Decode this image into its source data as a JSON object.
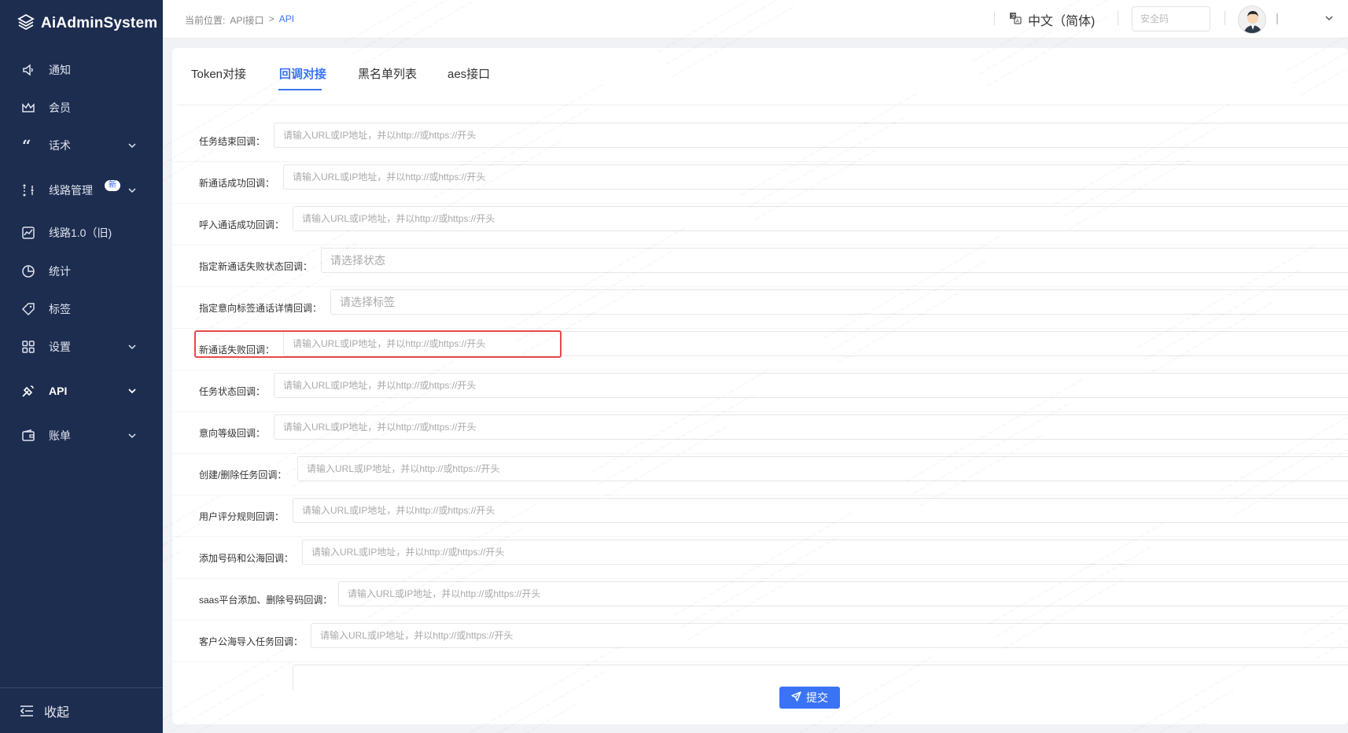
{
  "app": {
    "title": "AiAdminSystem"
  },
  "sidebar": {
    "items": [
      {
        "label": "通知",
        "icon": "speaker-icon",
        "has_chevron": false
      },
      {
        "label": "会员",
        "icon": "crown-icon",
        "has_chevron": false
      },
      {
        "label": "话术",
        "icon": "quote-icon",
        "has_chevron": true
      },
      {
        "label": "线路管理",
        "icon": "route-icon",
        "has_chevron": true,
        "badge": "新"
      },
      {
        "label": "线路1.0（旧)",
        "icon": "chart-box-icon",
        "has_chevron": false
      },
      {
        "label": "统计",
        "icon": "pie-icon",
        "has_chevron": false
      },
      {
        "label": "标签",
        "icon": "tag-icon",
        "has_chevron": false
      },
      {
        "label": "设置",
        "icon": "grid-icon",
        "has_chevron": true
      },
      {
        "label": "API",
        "icon": "satellite-icon",
        "has_chevron": true,
        "active": true
      },
      {
        "label": "账单",
        "icon": "wallet-icon",
        "has_chevron": true
      }
    ],
    "collapse_label": "收起"
  },
  "header": {
    "breadcrumb_prefix": "当前位置:",
    "breadcrumb_parent": "API接口",
    "breadcrumb_sep": ">",
    "breadcrumb_current": "API",
    "language": "中文（简体)",
    "safe_code_placeholder": "安全码"
  },
  "tabs": [
    {
      "label": "Token对接"
    },
    {
      "label": "回调对接",
      "active": true
    },
    {
      "label": "黑名单列表"
    },
    {
      "label": "aes接口"
    }
  ],
  "form": {
    "rows": [
      {
        "label": "任务结束回调：",
        "placeholder": "请输入URL或IP地址，并以http://或https://开头"
      },
      {
        "label": "新通话成功回调：",
        "placeholder": "请输入URL或IP地址，并以http://或https://开头"
      },
      {
        "label": "呼入通话成功回调：",
        "placeholder": "请输入URL或IP地址，并以http://或https://开头"
      },
      {
        "label": "指定新通话失败状态回调：",
        "placeholder": "请选择状态"
      },
      {
        "label": "指定意向标签通话详情回调：",
        "placeholder": "请选择标签"
      },
      {
        "label": "新通话失败回调：",
        "placeholder": "请输入URL或IP地址，并以http://或https://开头"
      },
      {
        "label": "任务状态回调：",
        "placeholder": "请输入URL或IP地址，并以http://或https://开头"
      },
      {
        "label": "意向等级回调：",
        "placeholder": "请输入URL或IP地址，并以http://或https://开头"
      },
      {
        "label": "创建/删除任务回调：",
        "placeholder": "请输入URL或IP地址，并以http://或https://开头"
      },
      {
        "label": "用户评分规则回调：",
        "placeholder": "请输入URL或IP地址，并以http://或https://开头"
      },
      {
        "label": "添加号码和公海回调：",
        "placeholder": "请输入URL或IP地址，并以http://或https://开头"
      },
      {
        "label": "saas平台添加、删除号码回调：",
        "placeholder": "请输入URL或IP地址，并以http://或https://开头"
      },
      {
        "label": "客户公海导入任务回调：",
        "placeholder": "请输入URL或IP地址，并以http://或https://开头"
      }
    ],
    "submit_label": "提交"
  },
  "colors": {
    "sidebar_bg": "#1d2d50",
    "accent": "#3a73f5",
    "highlight": "#e84a4a"
  }
}
